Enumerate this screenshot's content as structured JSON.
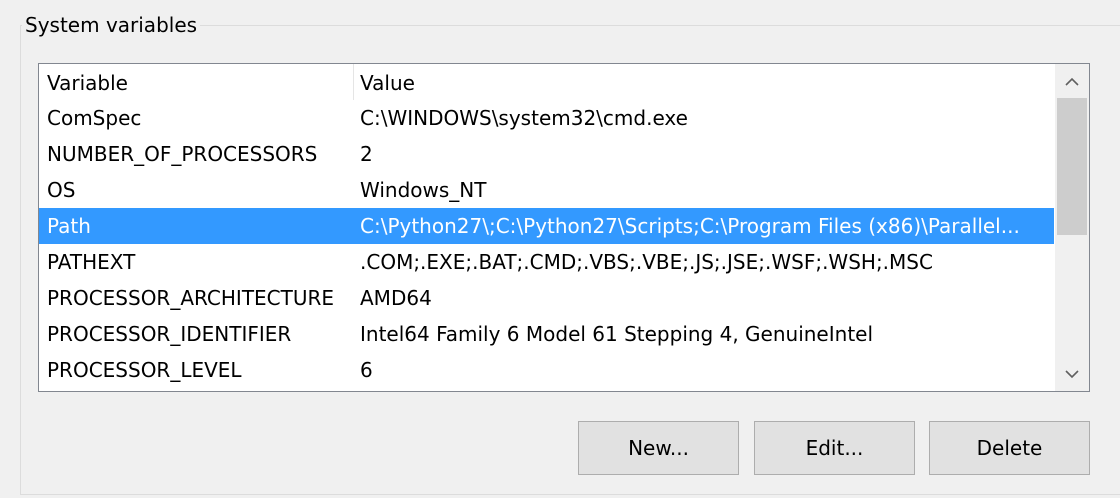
{
  "group": {
    "title": "System variables"
  },
  "list": {
    "columns": {
      "variable": "Variable",
      "value": "Value"
    },
    "rows": [
      {
        "variable": "ComSpec",
        "value": "C:\\WINDOWS\\system32\\cmd.exe",
        "selected": false
      },
      {
        "variable": "NUMBER_OF_PROCESSORS",
        "value": "2",
        "selected": false
      },
      {
        "variable": "OS",
        "value": "Windows_NT",
        "selected": false
      },
      {
        "variable": "Path",
        "value": "C:\\Python27\\;C:\\Python27\\Scripts;C:\\Program Files (x86)\\Parallel...",
        "selected": true
      },
      {
        "variable": "PATHEXT",
        "value": ".COM;.EXE;.BAT;.CMD;.VBS;.VBE;.JS;.JSE;.WSF;.WSH;.MSC",
        "selected": false
      },
      {
        "variable": "PROCESSOR_ARCHITECTURE",
        "value": "AMD64",
        "selected": false
      },
      {
        "variable": "PROCESSOR_IDENTIFIER",
        "value": "Intel64 Family 6 Model 61 Stepping 4, GenuineIntel",
        "selected": false
      },
      {
        "variable": "PROCESSOR_LEVEL",
        "value": "6",
        "selected": false
      }
    ],
    "scrollbar": {
      "up_icon": "chevron-up-icon",
      "down_icon": "chevron-down-icon"
    }
  },
  "buttons": {
    "new_label": "New...",
    "edit_label": "Edit...",
    "delete_label": "Delete"
  },
  "colors": {
    "selection": "#3399ff",
    "button_face": "#e1e1e1",
    "window_bg": "#f0f0f0"
  }
}
